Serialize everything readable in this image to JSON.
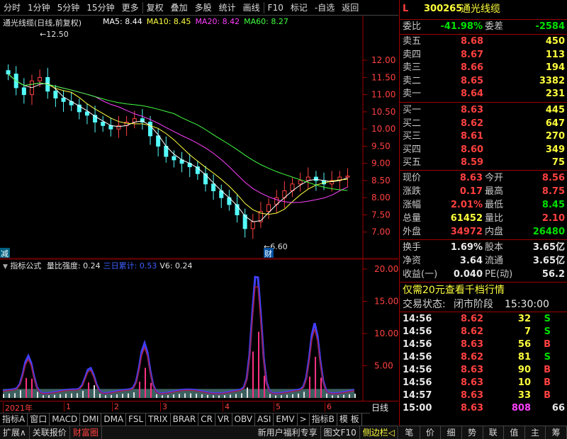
{
  "toolbar": {
    "items": [
      "分时",
      "1分钟",
      "5分钟",
      "15分钟",
      "更多",
      "复权",
      "叠加",
      "多股",
      "统计",
      "画线",
      "F10",
      "标记",
      "-自选",
      "返回"
    ]
  },
  "main": {
    "title": "通光线缆(日线,前复权)",
    "ma": [
      {
        "label": "MA5: 8.44",
        "color": "#ffffff"
      },
      {
        "label": "MA10: 8.45",
        "color": "#ffff40"
      },
      {
        "label": "MA20: 8.42",
        "color": "#ff40ff"
      },
      {
        "label": "MA60: 8.27",
        "color": "#40ff40"
      }
    ],
    "price_ticks": [
      "12.00",
      "11.50",
      "11.00",
      "10.50",
      "10.00",
      "9.50",
      "9.00",
      "8.50",
      "8.00",
      "7.50",
      "7.00"
    ],
    "high_label": "12.50",
    "low_label": "6.60",
    "marker_left": "减",
    "marker_cai": "财"
  },
  "sub": {
    "title": "指标公式",
    "series_labels": [
      {
        "label": "量比强度: 0.24",
        "color": "#e0e0e0"
      },
      {
        "label": "三日累计: 0.53",
        "color": "#4060ff"
      },
      {
        "label": "V6: 0.24",
        "color": "#e0e0e0"
      }
    ],
    "ticks": [
      "20.00",
      "15.00",
      "10.00",
      "5.00"
    ]
  },
  "date_axis": {
    "labels": [
      "2021年",
      "1",
      "2",
      "3",
      "4",
      "5",
      "6"
    ],
    "period": "日线"
  },
  "tabs1": [
    "指标A",
    "窗口",
    "MACD",
    "DMI",
    "DMA",
    "FSL",
    "TRIX",
    "BRAR",
    "CR",
    "VR",
    "OBV",
    "ASI",
    "EMV",
    ">",
    "指标B",
    "模 板"
  ],
  "tabs2": [
    "扩展∧",
    "关联报价",
    "财富圈"
  ],
  "tabs2_right": [
    "新用户福利专享",
    "图文F10",
    "侧边栏◁"
  ],
  "rp": {
    "flag": "L",
    "code": "300265",
    "name": "通光线缆",
    "weibi_label": "委比",
    "weibi": "-41.98%",
    "weicha_label": "委差",
    "weicha": "-2584",
    "asks": [
      {
        "label": "卖五",
        "price": "8.68",
        "vol": "450"
      },
      {
        "label": "卖四",
        "price": "8.67",
        "vol": "113"
      },
      {
        "label": "卖三",
        "price": "8.66",
        "vol": "194"
      },
      {
        "label": "卖二",
        "price": "8.65",
        "vol": "3382"
      },
      {
        "label": "卖一",
        "price": "8.64",
        "vol": "231"
      }
    ],
    "bids": [
      {
        "label": "买一",
        "price": "8.63",
        "vol": "445"
      },
      {
        "label": "买二",
        "price": "8.62",
        "vol": "647"
      },
      {
        "label": "买三",
        "price": "8.61",
        "vol": "270"
      },
      {
        "label": "买四",
        "price": "8.60",
        "vol": "349"
      },
      {
        "label": "买五",
        "price": "8.59",
        "vol": "75"
      }
    ],
    "stats": [
      {
        "l1": "现价",
        "v1": "8.63",
        "c1": "red",
        "l2": "今开",
        "v2": "8.56",
        "c2": "red"
      },
      {
        "l1": "涨跌",
        "v1": "0.17",
        "c1": "red",
        "l2": "最高",
        "v2": "8.75",
        "c2": "red"
      },
      {
        "l1": "涨幅",
        "v1": "2.01%",
        "c1": "red",
        "l2": "最低",
        "v2": "8.45",
        "c2": "green"
      },
      {
        "l1": "总量",
        "v1": "61452",
        "c1": "yellow",
        "l2": "量比",
        "v2": "2.10",
        "c2": "red"
      },
      {
        "l1": "外盘",
        "v1": "34972",
        "c1": "red",
        "l2": "内盘",
        "v2": "26480",
        "c2": "green"
      }
    ],
    "stats2": [
      {
        "l1": "换手",
        "v1": "1.69%",
        "l2": "股本",
        "v2": "3.65亿"
      },
      {
        "l1": "净资",
        "v1": "3.64",
        "l2": "流通",
        "v2": "3.65亿"
      },
      {
        "l1": "收益(一)",
        "v1": "0.040",
        "l2": "PE(动)",
        "v2": "56.2"
      }
    ],
    "promo": "仅需20元查看千档行情",
    "trade_state_label": "交易状态:",
    "trade_state": "闭市阶段",
    "trade_time": "15:30:00",
    "ticks": [
      {
        "t": "14:56",
        "p": "8.62",
        "v": "32",
        "d": "S"
      },
      {
        "t": "14:56",
        "p": "8.62",
        "v": "7",
        "d": "S"
      },
      {
        "t": "14:56",
        "p": "8.63",
        "v": "56",
        "d": "B"
      },
      {
        "t": "14:56",
        "p": "8.62",
        "v": "81",
        "d": "S"
      },
      {
        "t": "14:56",
        "p": "8.63",
        "v": "90",
        "d": "B"
      },
      {
        "t": "14:56",
        "p": "8.63",
        "v": "10",
        "d": "B"
      },
      {
        "t": "14:57",
        "p": "8.63",
        "v": "33",
        "d": "B"
      },
      {
        "t": "15:00",
        "p": "8.63",
        "v": "808",
        "d": "66"
      }
    ],
    "bottom_tabs": [
      "笔",
      "价",
      "细",
      "势",
      "联",
      "值",
      "主",
      "筹"
    ]
  },
  "chart_data": {
    "type": "line",
    "title": "通光线缆(日线,前复权)",
    "y_range": [
      6.5,
      12.6
    ],
    "candles_close_approx": [
      11.6,
      11.2,
      11.0,
      11.4,
      11.5,
      11.1,
      10.9,
      10.8,
      10.7,
      10.5,
      10.4,
      10.2,
      10.1,
      10.0,
      10.1,
      10.2,
      10.3,
      10.2,
      9.8,
      9.5,
      9.2,
      9.1,
      9.0,
      8.9,
      8.7,
      8.4,
      8.2,
      8.0,
      7.8,
      7.5,
      7.1,
      7.3,
      7.6,
      7.8,
      8.0,
      8.2,
      8.4,
      8.5,
      8.6,
      8.5,
      8.4,
      8.5,
      8.6,
      8.63
    ],
    "series": [
      {
        "name": "MA5",
        "last": 8.44
      },
      {
        "name": "MA10",
        "last": 8.45
      },
      {
        "name": "MA20",
        "last": 8.42
      },
      {
        "name": "MA60",
        "last": 8.27
      }
    ]
  }
}
